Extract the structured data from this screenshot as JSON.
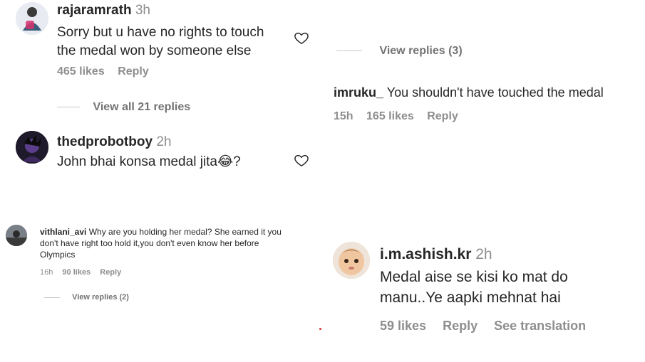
{
  "comments": [
    {
      "username": "rajaramrath",
      "time": "3h",
      "text_line1": "Sorry but u have no rights to touch",
      "text_line2": "the medal won by someone else",
      "likes": "465 likes",
      "reply": "Reply",
      "view_replies": "View all 21 replies"
    },
    {
      "username": "thedprobotboy",
      "time": "2h",
      "text": "John bhai konsa medal jita😂?"
    },
    {
      "username": "vithlani_avi",
      "text": "Why are you holding her medal? She earned it you",
      "text_line2": "don't have right too hold it,you don't even know her before",
      "text_line3": "Olympics",
      "time": "16h",
      "likes": "90 likes",
      "reply": "Reply",
      "view_replies": "View replies (2)"
    }
  ],
  "right_comments": {
    "top_view_replies": "View replies (3)",
    "imruku": {
      "username": "imruku_",
      "text": "You shouldn't have touched the medal",
      "time": "15h",
      "likes": "165 likes",
      "reply": "Reply"
    },
    "ashish": {
      "username": "i.m.ashish.kr",
      "time": "2h",
      "text_line1": "Medal aise se kisi ko mat do",
      "text_line2": "manu..Ye aapki mehnat hai",
      "likes": "59 likes",
      "reply": "Reply",
      "see_translation": "See translation"
    }
  },
  "icons": {
    "like": "heart-outline-icon"
  },
  "colors": {
    "text": "#262626",
    "muted": "#8e8e8e",
    "divider": "#c7c7c7"
  }
}
